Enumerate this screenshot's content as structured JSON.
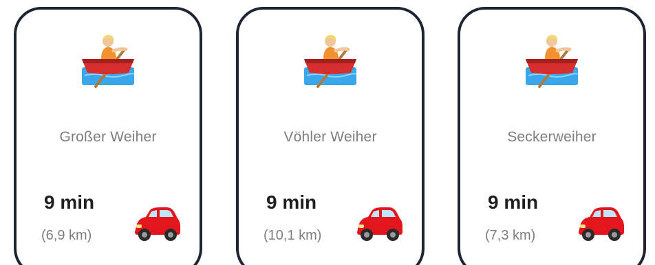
{
  "cards": [
    {
      "name": "Großer Weiher",
      "time": "9 min",
      "distance": "(6,9 km)",
      "activity_icon": "person-rowing-boat-icon",
      "transport_icon": "car-icon"
    },
    {
      "name": "Vöhler Weiher",
      "time": "9 min",
      "distance": "(10,1 km)",
      "activity_icon": "person-rowing-boat-icon",
      "transport_icon": "car-icon"
    },
    {
      "name": "Seckerweiher",
      "time": "9 min",
      "distance": "(7,3 km)",
      "activity_icon": "person-rowing-boat-icon",
      "transport_icon": "car-icon"
    }
  ],
  "colors": {
    "card_border": "#1d2533",
    "name_text": "#7e7e7e",
    "time_text": "#1f1f1f",
    "boat_red": "#d62e2e",
    "water_blue": "#3aa7ea",
    "car_red": "#e4161d"
  }
}
